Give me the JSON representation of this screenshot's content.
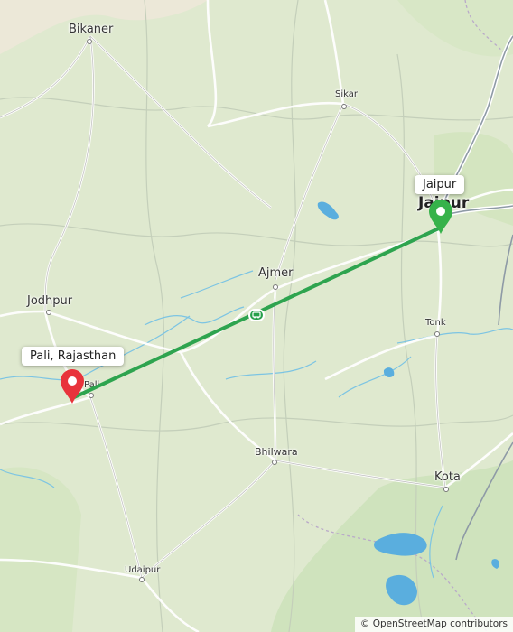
{
  "map": {
    "cities": [
      {
        "id": "bikaner",
        "name": "Bikaner"
      },
      {
        "id": "sikar",
        "name": "Sikar"
      },
      {
        "id": "jaipur",
        "name": "Jaipur"
      },
      {
        "id": "jodhpur",
        "name": "Jodhpur"
      },
      {
        "id": "ajmer",
        "name": "Ajmer"
      },
      {
        "id": "tonk",
        "name": "Tonk"
      },
      {
        "id": "pali",
        "name": "Pali"
      },
      {
        "id": "bhilwara",
        "name": "Bhilwara"
      },
      {
        "id": "kota",
        "name": "Kota"
      },
      {
        "id": "udaipur",
        "name": "Udaipur"
      }
    ],
    "route": {
      "origin_label": "Pali, Rajasthan",
      "destination_label": "Jaipur",
      "line_color": "#2ea44f",
      "origin_marker_color": "#e8333b",
      "destination_marker_color": "#36b24a",
      "midpoint_icon": "transport-icon"
    },
    "attribution": "© OpenStreetMap contributors"
  }
}
